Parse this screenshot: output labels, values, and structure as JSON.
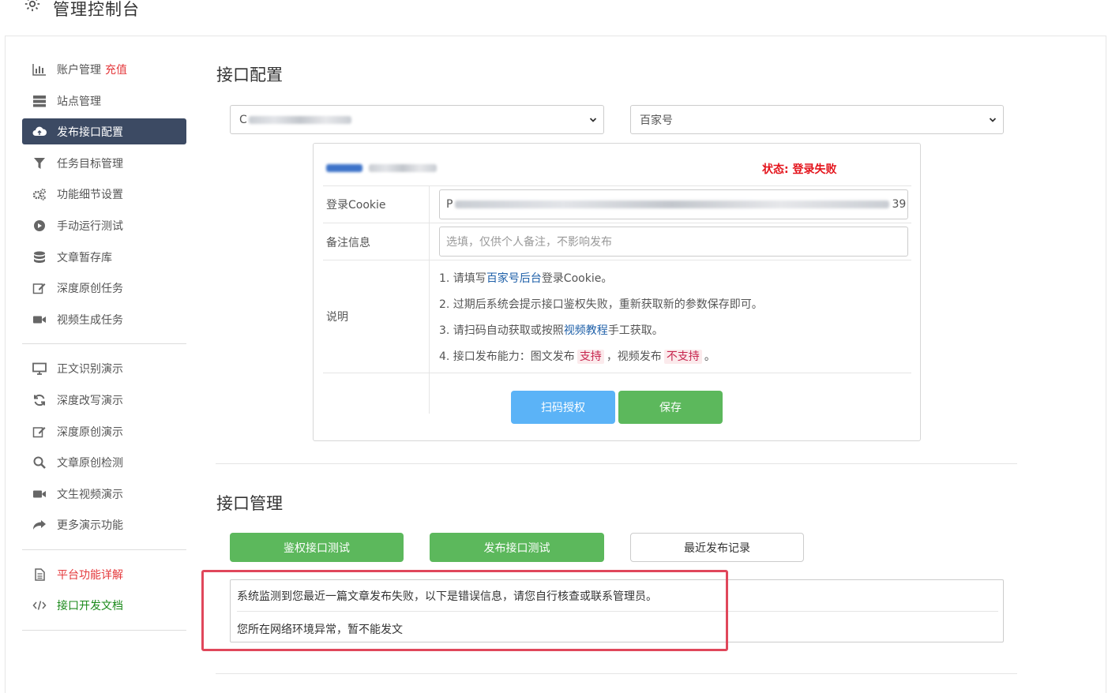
{
  "header": {
    "title": "管理控制台",
    "icon": "gear-icon"
  },
  "sidebar": {
    "items": [
      {
        "label": "账户管理",
        "extra": "充值",
        "icon": "bar-chart-icon"
      },
      {
        "label": "站点管理",
        "icon": "server-icon"
      },
      {
        "label": "发布接口配置",
        "icon": "cloud-upload-icon",
        "active": true
      },
      {
        "label": "任务目标管理",
        "icon": "filter-icon"
      },
      {
        "label": "功能细节设置",
        "icon": "cogs-icon"
      },
      {
        "label": "手动运行测试",
        "icon": "play-circle-icon"
      },
      {
        "label": "文章暂存库",
        "icon": "database-icon"
      },
      {
        "label": "深度原创任务",
        "icon": "edit-icon"
      },
      {
        "label": "视频生成任务",
        "icon": "video-camera-icon"
      }
    ],
    "demo_items": [
      {
        "label": "正文识别演示",
        "icon": "monitor-icon"
      },
      {
        "label": "深度改写演示",
        "icon": "refresh-icon"
      },
      {
        "label": "深度原创演示",
        "icon": "edit-icon"
      },
      {
        "label": "文章原创检测",
        "icon": "search-icon"
      },
      {
        "label": "文生视频演示",
        "icon": "video-camera-icon"
      },
      {
        "label": "更多演示功能",
        "icon": "share-icon"
      }
    ],
    "doc_items": [
      {
        "label": "平台功能详解",
        "icon": "document-icon",
        "color": "#e4393c"
      },
      {
        "label": "接口开发文档",
        "icon": "code-icon",
        "color": "#1b8a1b"
      }
    ]
  },
  "config": {
    "heading": "接口配置",
    "site_select_value": "C",
    "platform_select_value": "百家号",
    "account_name": "",
    "status": "状态: 登录失败",
    "cookie_label": "登录Cookie",
    "cookie_value_prefix": "P",
    "cookie_value_suffix": "39",
    "note_label": "备注信息",
    "note_placeholder": "选填，仅供个人备注，不影响发布",
    "desc_label": "说明",
    "desc": {
      "l1_a": "1. 请填写",
      "l1_link": "百家号后台",
      "l1_b": "登录Cookie。",
      "l2": "2. 过期后系统会提示接口鉴权失败，重新获取新的参数保存即可。",
      "l3_a": "3. 请扫码自动获取或按照",
      "l3_link": "视频教程",
      "l3_b": "手工获取。",
      "l4_a": "4. 接口发布能力：图文发布",
      "l4_ok": "支持",
      "l4_mid": "，视频发布",
      "l4_no": "不支持",
      "l4_end": "。"
    },
    "scan_button": "扫码授权",
    "save_button": "保存"
  },
  "manage": {
    "heading": "接口管理",
    "auth_test_button": "鉴权接口测试",
    "publish_test_button": "发布接口测试",
    "recent_button": "最近发布记录",
    "error_line1": "系统监测到您最近一篇文章发布失败，以下是错误信息，请您自行核查或联系管理员。",
    "error_line2": "您所在网络环境异常，暂不能发文"
  },
  "colors": {
    "sidebar_active": "#3c4a63",
    "green": "#5cb85c",
    "blue": "#5bb3f7",
    "status_red": "#e4141c",
    "highlight": "#e0475b"
  }
}
